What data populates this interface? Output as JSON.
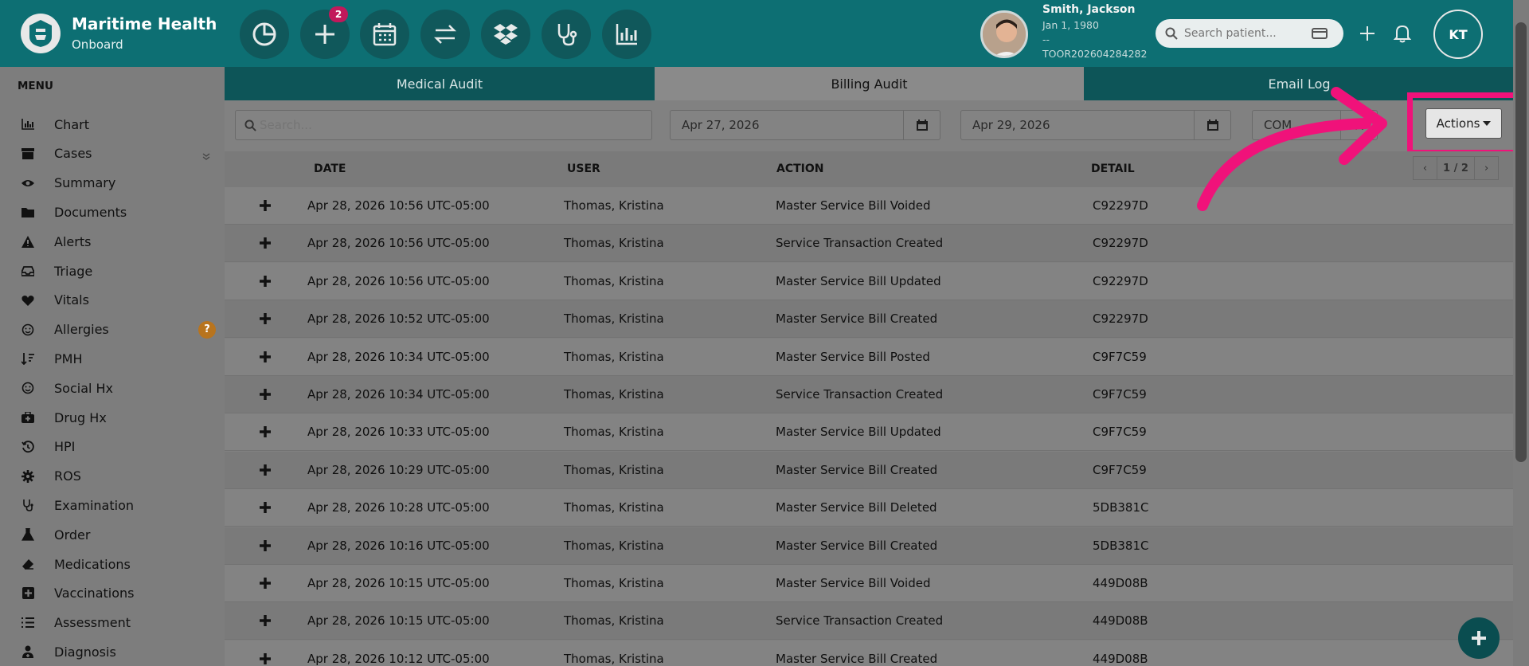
{
  "brand": {
    "name": "Maritime Health",
    "subtitle": "Onboard"
  },
  "quick_actions": [
    {
      "name": "pie-chart-icon"
    },
    {
      "name": "plus-icon",
      "badge": "2"
    },
    {
      "name": "calendar-icon"
    },
    {
      "name": "transfer-icon"
    },
    {
      "name": "dropbox-icon"
    },
    {
      "name": "stethoscope-icon"
    },
    {
      "name": "bar-chart-icon"
    }
  ],
  "patient": {
    "name": "Smith, Jackson",
    "dob": "Jan 1, 1980",
    "extra": "--",
    "id": "TOOR202604284282"
  },
  "search_patient": {
    "placeholder": "Search patient..."
  },
  "user_initials": "KT",
  "menu": {
    "title": "MENU",
    "items": [
      {
        "label": "Chart",
        "icon": "bar-chart-icon"
      },
      {
        "label": "Cases",
        "icon": "archive-icon",
        "collapse": true
      },
      {
        "label": "Summary",
        "icon": "eye-icon"
      },
      {
        "label": "Documents",
        "icon": "folder-icon"
      },
      {
        "label": "Alerts",
        "icon": "warning-icon"
      },
      {
        "label": "Triage",
        "icon": "inbox-icon"
      },
      {
        "label": "Vitals",
        "icon": "heart-icon"
      },
      {
        "label": "Allergies",
        "icon": "smile-icon",
        "help": "?"
      },
      {
        "label": "PMH",
        "icon": "sort-icon"
      },
      {
        "label": "Social Hx",
        "icon": "smile-icon"
      },
      {
        "label": "Drug Hx",
        "icon": "medkit-icon"
      },
      {
        "label": "HPI",
        "icon": "history-icon"
      },
      {
        "label": "ROS",
        "icon": "gear-icon"
      },
      {
        "label": "Examination",
        "icon": "stethoscope-icon"
      },
      {
        "label": "Order",
        "icon": "flask-icon"
      },
      {
        "label": "Medications",
        "icon": "eraser-icon"
      },
      {
        "label": "Vaccinations",
        "icon": "plus-square-icon"
      },
      {
        "label": "Assessment",
        "icon": "list-icon"
      },
      {
        "label": "Diagnosis",
        "icon": "user-md-icon"
      }
    ]
  },
  "tabs": [
    {
      "label": "Medical Audit",
      "active": false
    },
    {
      "label": "Billing Audit",
      "active": true
    },
    {
      "label": "Email Log",
      "active": false
    }
  ],
  "filters": {
    "search_placeholder": "Search...",
    "date_from": "Apr 27, 2026",
    "date_to": "Apr 29, 2026",
    "status_value": "COM",
    "actions_label": "Actions"
  },
  "table": {
    "columns": [
      "DATE",
      "USER",
      "ACTION",
      "DETAIL"
    ],
    "pager": {
      "prev": "‹",
      "page": "1 / 2",
      "next": "›"
    },
    "rows": [
      {
        "date": "Apr 28, 2026 10:56 UTC-05:00",
        "user": "Thomas, Kristina",
        "action": "Master Service Bill Voided",
        "detail": "C92297D"
      },
      {
        "date": "Apr 28, 2026 10:56 UTC-05:00",
        "user": "Thomas, Kristina",
        "action": "Service Transaction Created",
        "detail": "C92297D"
      },
      {
        "date": "Apr 28, 2026 10:56 UTC-05:00",
        "user": "Thomas, Kristina",
        "action": "Master Service Bill Updated",
        "detail": "C92297D"
      },
      {
        "date": "Apr 28, 2026 10:52 UTC-05:00",
        "user": "Thomas, Kristina",
        "action": "Master Service Bill Created",
        "detail": "C92297D"
      },
      {
        "date": "Apr 28, 2026 10:34 UTC-05:00",
        "user": "Thomas, Kristina",
        "action": "Master Service Bill Posted",
        "detail": "C9F7C59"
      },
      {
        "date": "Apr 28, 2026 10:34 UTC-05:00",
        "user": "Thomas, Kristina",
        "action": "Service Transaction Created",
        "detail": "C9F7C59"
      },
      {
        "date": "Apr 28, 2026 10:33 UTC-05:00",
        "user": "Thomas, Kristina",
        "action": "Master Service Bill Updated",
        "detail": "C9F7C59"
      },
      {
        "date": "Apr 28, 2026 10:29 UTC-05:00",
        "user": "Thomas, Kristina",
        "action": "Master Service Bill Created",
        "detail": "C9F7C59"
      },
      {
        "date": "Apr 28, 2026 10:28 UTC-05:00",
        "user": "Thomas, Kristina",
        "action": "Master Service Bill Deleted",
        "detail": "5DB381C"
      },
      {
        "date": "Apr 28, 2026 10:16 UTC-05:00",
        "user": "Thomas, Kristina",
        "action": "Master Service Bill Created",
        "detail": "5DB381C"
      },
      {
        "date": "Apr 28, 2026 10:15 UTC-05:00",
        "user": "Thomas, Kristina",
        "action": "Master Service Bill Voided",
        "detail": "449D08B"
      },
      {
        "date": "Apr 28, 2026 10:15 UTC-05:00",
        "user": "Thomas, Kristina",
        "action": "Service Transaction Created",
        "detail": "449D08B"
      },
      {
        "date": "Apr 28, 2026 10:12 UTC-05:00",
        "user": "Thomas, Kristina",
        "action": "Master Service Bill Created",
        "detail": "449D08B"
      }
    ]
  },
  "colors": {
    "brand_teal": "#0d6f73",
    "highlight_pink": "#f0127a",
    "badge_pink": "#c2185b",
    "help_orange": "#b8741e"
  }
}
